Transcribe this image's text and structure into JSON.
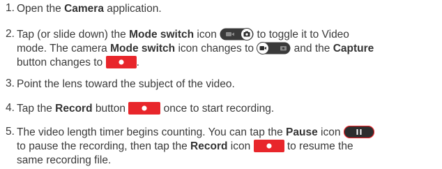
{
  "colors": {
    "text": "#3a3a3a",
    "record_red": "#e8262b",
    "icon_dark": "#2d2d2d"
  },
  "steps": [
    {
      "num": "1.",
      "a": "Open the ",
      "b1": "Camera",
      "c": " application."
    },
    {
      "num": "2.",
      "a": "Tap (or slide down) the ",
      "b1": "Mode switch",
      "c": " icon",
      "d": "to toggle it to Video",
      "e": "mode. The camera ",
      "b2": "Mode switch",
      "f": " icon changes to",
      "g": "and the ",
      "b3": "Capture",
      "h": "button changes to",
      "i": "."
    },
    {
      "num": "3.",
      "a": "Point the lens toward the subject of the video."
    },
    {
      "num": "4.",
      "a": "Tap the ",
      "b1": "Record",
      "c": " button",
      "d": "once to start recording."
    },
    {
      "num": "5.",
      "a": "The video length timer begins counting. You can tap the ",
      "b1": "Pause",
      "c": " icon",
      "d": "to pause the recording, then tap the ",
      "b2": "Record",
      "e": " icon",
      "f": "to resume the",
      "g": "same recording file."
    }
  ],
  "icons": {
    "mode_switch_photo": "mode-switch-photo-icon",
    "mode_switch_video": "mode-switch-video-icon",
    "record_button": "record-button-icon",
    "pause": "pause-icon"
  }
}
